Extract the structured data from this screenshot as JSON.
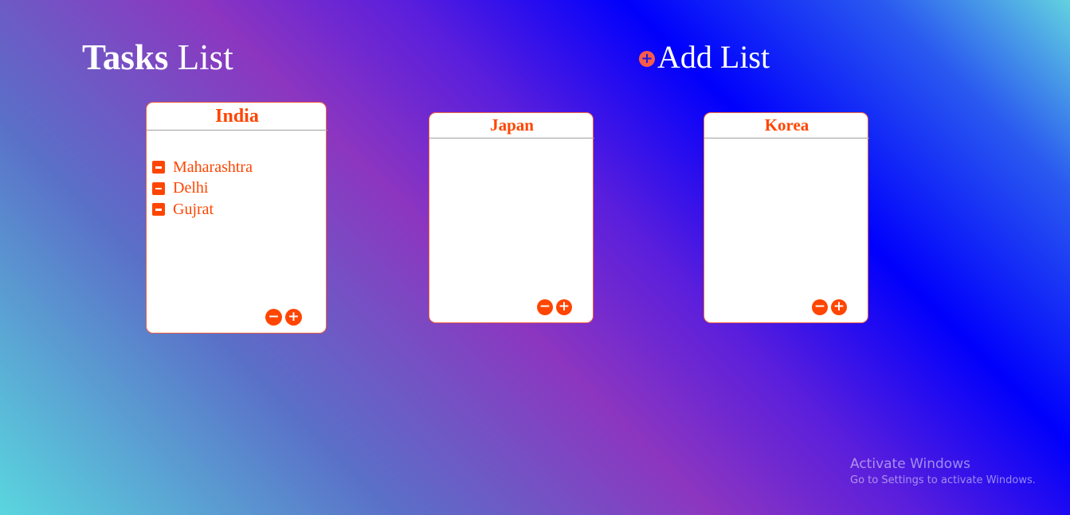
{
  "header": {
    "title_bold": "Tasks",
    "title_rest": " List",
    "add_list_label": "Add List",
    "add_list_icon": "plus-circle-icon"
  },
  "lists": [
    {
      "name": "India",
      "items": [
        "Maharashtra",
        "Delhi",
        "Gujrat"
      ]
    },
    {
      "name": "Japan",
      "items": []
    },
    {
      "name": "Korea",
      "items": []
    }
  ],
  "card_buttons": {
    "remove": "−",
    "add": "+"
  },
  "watermark": {
    "line1": "Activate Windows",
    "line2": "Go to Settings to activate Windows."
  },
  "colors": {
    "accent": "#ff4500",
    "add_icon": "#f95b4a"
  }
}
